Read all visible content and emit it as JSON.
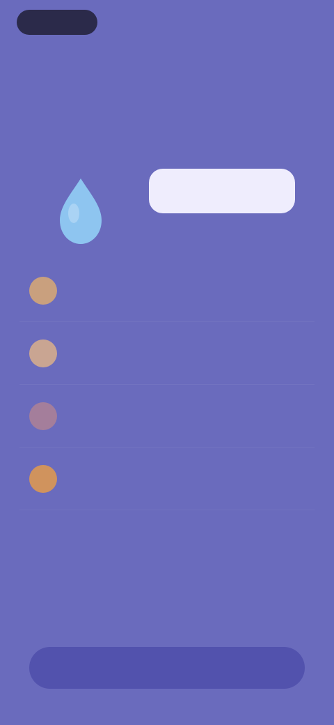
{
  "status": {
    "pill_label": ""
  },
  "header": {
    "headline_line1": "",
    "headline_line2": ""
  },
  "hero": {
    "character_icon": "raindrop-character-icon",
    "bubble_text": ""
  },
  "list": {
    "items": [
      {
        "icon": "circle-icon",
        "icon_color": "#c9a07e",
        "title": "",
        "value": ""
      },
      {
        "icon": "circle-icon",
        "icon_color": "#c9a592",
        "title": "",
        "value": ""
      },
      {
        "icon": "circle-icon",
        "icon_color": "#a47e9b",
        "title": "",
        "value": ""
      },
      {
        "icon": "circle-icon",
        "icon_color": "#d0935d",
        "title": "",
        "value": ""
      }
    ]
  },
  "cta": {
    "label": ""
  },
  "colors": {
    "background": "#6a6bbd",
    "button": "#5252ad",
    "bubble": "#f5f3ff",
    "character": "#8ec5f0"
  }
}
